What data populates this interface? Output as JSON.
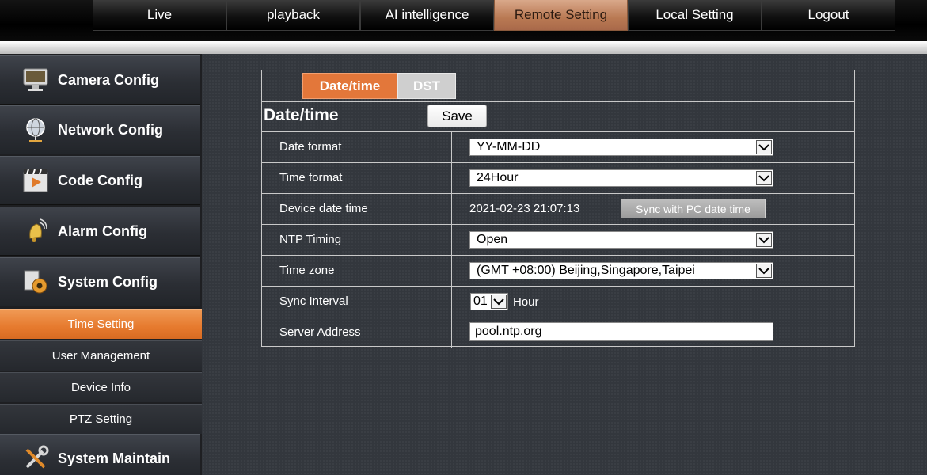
{
  "topnav": {
    "tabs": [
      {
        "label": "Live"
      },
      {
        "label": "playback"
      },
      {
        "label": "AI intelligence"
      },
      {
        "label": "Remote Setting"
      },
      {
        "label": "Local Setting"
      },
      {
        "label": "Logout"
      }
    ],
    "active": "Remote Setting"
  },
  "sidebar": {
    "sections": [
      {
        "label": "Camera Config",
        "icon": "monitor-icon"
      },
      {
        "label": "Network Config",
        "icon": "globe-icon"
      },
      {
        "label": "Code Config",
        "icon": "video-play-icon"
      },
      {
        "label": "Alarm Config",
        "icon": "alarm-bell-icon"
      },
      {
        "label": "System Config",
        "icon": "system-gear-icon"
      },
      {
        "label": "System Maintain",
        "icon": "tools-icon"
      }
    ],
    "subitems": [
      {
        "label": "Time Setting",
        "active": true
      },
      {
        "label": "User Management"
      },
      {
        "label": "Device Info"
      },
      {
        "label": "PTZ Setting"
      }
    ]
  },
  "panel": {
    "tabs": [
      {
        "label": "Date/time",
        "active": true
      },
      {
        "label": "DST"
      }
    ],
    "title": "Date/time",
    "save_label": "Save",
    "rows": {
      "date_format": {
        "label": "Date format",
        "value": "YY-MM-DD"
      },
      "time_format": {
        "label": "Time format",
        "value": "24Hour"
      },
      "device_datetime": {
        "label": "Device date time",
        "value": "2021-02-23 21:07:13",
        "button": "Sync with PC date time"
      },
      "ntp_timing": {
        "label": "NTP Timing",
        "value": "Open"
      },
      "time_zone": {
        "label": "Time zone",
        "value": "(GMT +08:00) Beijing,Singapore,Taipei"
      },
      "sync_interval": {
        "label": "Sync Interval",
        "value": "01",
        "unit": "Hour"
      },
      "server_address": {
        "label": "Server Address",
        "value": "pool.ntp.org"
      }
    }
  },
  "colors": {
    "accent": "#e3773a",
    "active_top_tab": "#b97953",
    "background": "#33373d"
  }
}
